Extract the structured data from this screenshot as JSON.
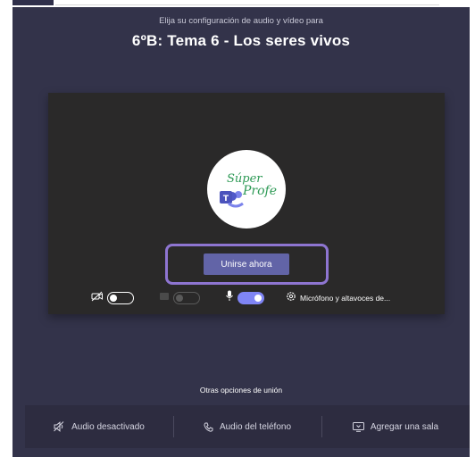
{
  "header": {
    "subtitle": "Elija su configuración de audio y vídeo para",
    "title": "6ºB: Tema 6 - Los seres vivos"
  },
  "avatar": {
    "logo_text_line1": "Súper",
    "logo_text_line2": "Profe",
    "logo_badge": "T"
  },
  "join_button": {
    "label": "Unirse ahora"
  },
  "controls": {
    "camera": {
      "state": "off",
      "icon": "camera-off-icon"
    },
    "background": {
      "state": "disabled",
      "icon": "background-blur-icon"
    },
    "microphone": {
      "state": "on",
      "icon": "microphone-icon"
    },
    "device_settings": {
      "icon": "gear-icon",
      "label": "Micrófono y altavoces de..."
    }
  },
  "other_options": {
    "heading": "Otras opciones de unión",
    "items": [
      {
        "icon": "speaker-off-icon",
        "label": "Audio desactivado"
      },
      {
        "icon": "phone-icon",
        "label": "Audio del teléfono"
      },
      {
        "icon": "cast-icon",
        "label": "Agregar una sala"
      }
    ]
  },
  "colors": {
    "background": "#33334a",
    "preview": "#2a2929",
    "accent": "#6264a7",
    "highlight_outline": "#8e75d1",
    "toggle_on": "#7f85f5"
  }
}
